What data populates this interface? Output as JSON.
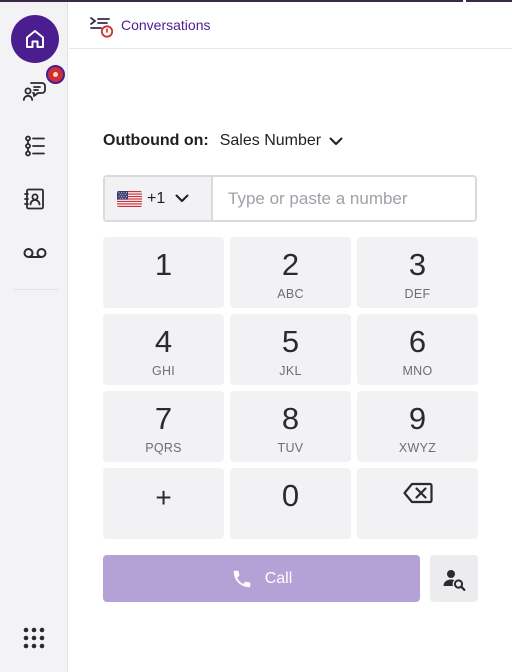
{
  "header": {
    "title": "Conversations",
    "icon": "conversations-icon"
  },
  "sidebar": {
    "items": [
      {
        "name": "home",
        "icon": "home-icon",
        "active": true
      },
      {
        "name": "conversations",
        "icon": "chat-person-icon",
        "has_badge": true
      },
      {
        "name": "lists",
        "icon": "checklist-icon"
      },
      {
        "name": "contacts",
        "icon": "contact-book-icon"
      },
      {
        "name": "voicemail",
        "icon": "voicemail-icon"
      }
    ],
    "apps_icon": "grid-apps-icon"
  },
  "outbound": {
    "label": "Outbound on:",
    "selected": "Sales Number"
  },
  "dialer": {
    "country_code": "+1",
    "country_flag": "us-flag-icon",
    "placeholder": "Type or paste a number"
  },
  "keypad": {
    "keys": [
      {
        "digit": "1",
        "letters": ""
      },
      {
        "digit": "2",
        "letters": "ABC"
      },
      {
        "digit": "3",
        "letters": "DEF"
      },
      {
        "digit": "4",
        "letters": "GHI"
      },
      {
        "digit": "5",
        "letters": "JKL"
      },
      {
        "digit": "6",
        "letters": "MNO"
      },
      {
        "digit": "7",
        "letters": "PQRS"
      },
      {
        "digit": "8",
        "letters": "TUV"
      },
      {
        "digit": "9",
        "letters": "XWYZ"
      },
      {
        "digit": "+",
        "letters": ""
      },
      {
        "digit": "0",
        "letters": ""
      },
      {
        "digit": "",
        "letters": "",
        "icon": "backspace-icon"
      }
    ]
  },
  "call": {
    "label": "Call",
    "icon": "phone-icon"
  },
  "lookup": {
    "icon": "contact-search-icon"
  },
  "colors": {
    "accent": "#4a1e8f",
    "call_button": "#b4a1d6",
    "badge": "#cf2f34"
  }
}
